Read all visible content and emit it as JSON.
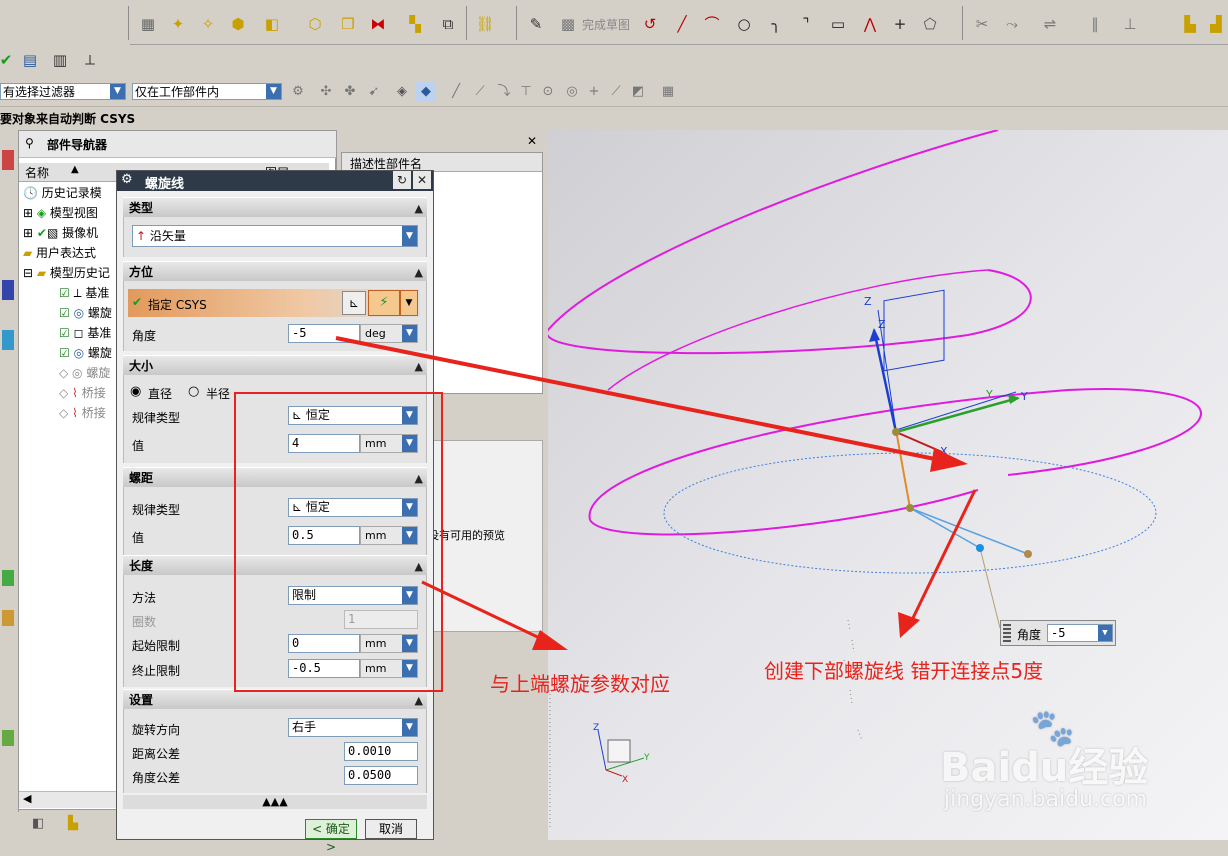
{
  "toolbar": {
    "finish_sketch_label": "完成草图",
    "filter_value": "有选择过滤器",
    "scope_value": "仅在工作部件内",
    "csys_hint": "要对象来自动判断 CSYS"
  },
  "navigator": {
    "title": "部件导航器",
    "col_name": "名称",
    "col_layer": "图层",
    "items": [
      {
        "label": "历史记录模"
      },
      {
        "label": "模型视图"
      },
      {
        "label": "摄像机"
      },
      {
        "label": "用户表达式"
      },
      {
        "label": "模型历史记"
      },
      {
        "label": "基准"
      },
      {
        "label": "螺旋"
      },
      {
        "label": "基准"
      },
      {
        "label": "螺旋"
      },
      {
        "label": "螺旋"
      },
      {
        "label": "桥接"
      },
      {
        "label": "桥接"
      }
    ]
  },
  "side_panel": {
    "header": "描述性部件名",
    "no_preview": "没有可用的预览"
  },
  "dialog": {
    "title": "螺旋线",
    "type": {
      "header": "类型",
      "value": "沿矢量"
    },
    "orientation": {
      "header": "方位",
      "csys_label": "指定 CSYS",
      "angle_label": "角度",
      "angle_value": "-5",
      "angle_unit": "deg"
    },
    "size": {
      "header": "大小",
      "diameter_label": "直径",
      "radius_label": "半径",
      "law_label": "规律类型",
      "law_value": "恒定",
      "value_label": "值",
      "value": "4",
      "unit": "mm"
    },
    "pitch": {
      "header": "螺距",
      "law_label": "规律类型",
      "law_value": "恒定",
      "value_label": "值",
      "value": "0.5",
      "unit": "mm"
    },
    "length": {
      "header": "长度",
      "method_label": "方法",
      "method_value": "限制",
      "turns_label": "圈数",
      "turns_value": "1",
      "start_label": "起始限制",
      "start_value": "0",
      "start_unit": "mm",
      "end_label": "终止限制",
      "end_value": "-0.5",
      "end_unit": "mm"
    },
    "settings": {
      "header": "设置",
      "rotation_label": "旋转方向",
      "rotation_value": "右手",
      "dist_tol_label": "距离公差",
      "dist_tol_value": "0.0010",
      "angle_tol_label": "角度公差",
      "angle_tol_value": "0.0500"
    },
    "ok_label": "< 确定 >",
    "cancel_label": "取消"
  },
  "viewport": {
    "angle_tag_label": "角度",
    "angle_tag_value": "-5",
    "axis_z": "Z",
    "axis_y": "Y",
    "axis_x": "X"
  },
  "annotations": {
    "note1": "与上端螺旋参数对应",
    "note2": "创建下部螺旋线 错开连接点5度"
  },
  "watermark": {
    "brand": "Baidu经验",
    "url": "jingyan.baidu.com"
  },
  "colors": {
    "annotation_red": "#e8231c",
    "helix_magenta": "#e01be0",
    "dialog_title_bg": "#2f3a48"
  }
}
